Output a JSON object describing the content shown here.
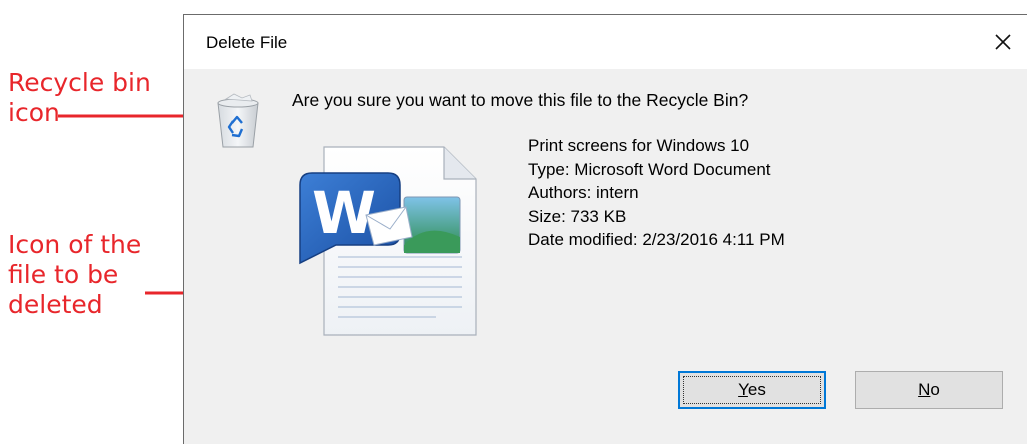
{
  "annotations": {
    "recycle_label_line1": "Recycle bin",
    "recycle_label_line2": "icon",
    "file_label_line1": "Icon of the",
    "file_label_line2": "file to be",
    "file_label_line3": "deleted",
    "color": "#e8262b"
  },
  "dialog": {
    "title": "Delete File",
    "question": "Are you sure you want to move this file to the Recycle Bin?",
    "details": [
      "Print screens for Windows 10",
      "Type: Microsoft Word Document",
      "Authors: intern",
      "Size: 733 KB",
      "Date modified: 2/23/2016 4:11 PM"
    ],
    "yes_label": "Yes",
    "no_label": "No",
    "icons": {
      "close": "close-icon",
      "recycle": "recycle-bin-icon",
      "file": "word-document-icon"
    },
    "accent_color": "#0078d7"
  }
}
